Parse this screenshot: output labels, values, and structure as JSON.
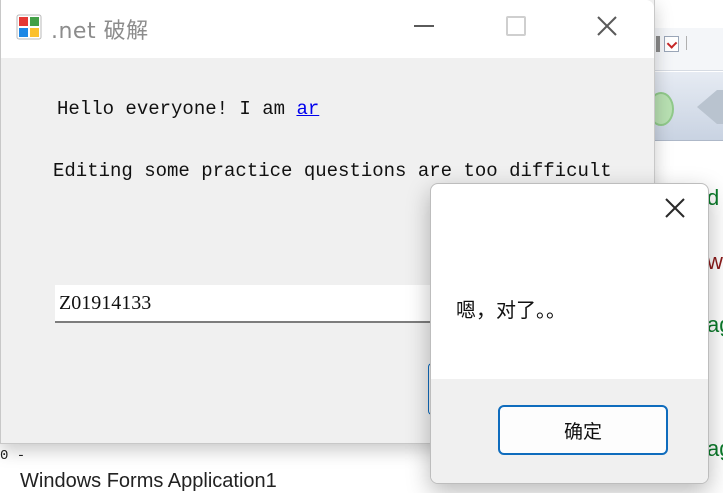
{
  "window": {
    "title": ".net 破解",
    "app_icon": "windows-app-icon",
    "controls": {
      "minimize": "minimize-icon",
      "maximize": "maximize-icon",
      "close": "close-icon"
    }
  },
  "content": {
    "hello_text": "Hello everyone! I am ",
    "hello_link": "ar",
    "edit_text": "Editing some practice questions are too difficult",
    "input_value": "Z01914133"
  },
  "dialog": {
    "message": "嗯，对了。。",
    "ok_label": "确定",
    "close_icon": "close-icon"
  },
  "background": {
    "bottom_dash": "0 -",
    "bottom_text": "Windows Forms Application1",
    "code_fragments": [
      "d",
      "w",
      "ag",
      "ag"
    ]
  },
  "colors": {
    "accent": "#0f6cbd",
    "link": "#0000ee",
    "code_green": "#0a7a2a",
    "code_red": "#8b1b1b"
  }
}
